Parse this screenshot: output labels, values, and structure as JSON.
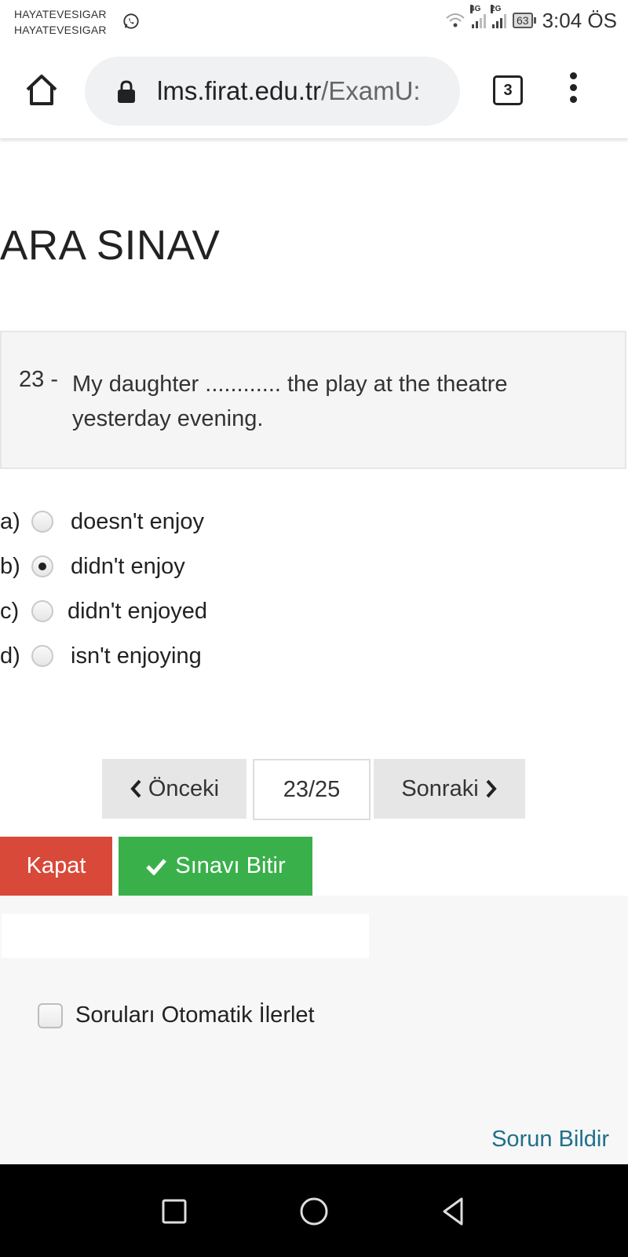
{
  "status_bar": {
    "left_line1": "HAYATEVESIGAR",
    "left_line2": "HAYATEVESIGAR",
    "net1": "4G",
    "net2": "2G",
    "battery": "63",
    "time": "3:04 ÖS"
  },
  "browser": {
    "url_domain": "lms.firat.edu.tr",
    "url_path": "/ExamU:",
    "tab_count": "3"
  },
  "exam": {
    "title": "ARA SINAV",
    "question_number": "23 -",
    "question_text": "My daughter ............ the play at the theatre yesterday evening.",
    "options": [
      {
        "letter": "a)",
        "text": "doesn't enjoy",
        "selected": false
      },
      {
        "letter": "b)",
        "text": "didn't enjoy",
        "selected": true
      },
      {
        "letter": "c)",
        "text": "didn't enjoyed",
        "selected": false
      },
      {
        "letter": "d)",
        "text": "isn't enjoying",
        "selected": false
      }
    ]
  },
  "pagination": {
    "prev_label": "Önceki",
    "indicator": "23/25",
    "next_label": "Sonraki"
  },
  "actions": {
    "close_label": "Kapat",
    "finish_label": "Sınavı Bitir"
  },
  "auto_advance_label": "Soruları Otomatik İlerlet",
  "report_label": "Sorun Bildir",
  "colors": {
    "close_button": "#d9493a",
    "finish_button": "#3ab04b",
    "link": "#1f6f8b"
  }
}
